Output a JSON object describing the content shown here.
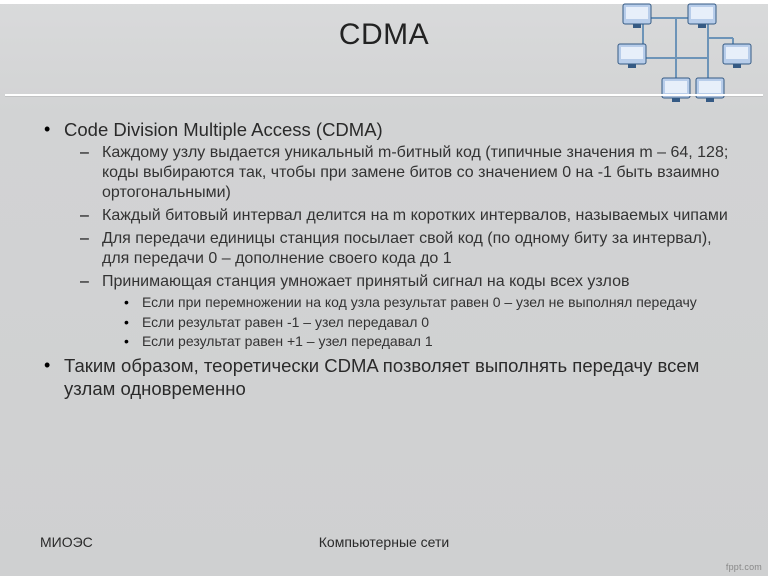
{
  "title": "CDMA",
  "bullets_lvl1_0": "Code Division Multiple Access (CDMA)",
  "bullets_lvl2_0": "Каждому узлу выдается уникальный m-битный код (типичные значения m – 64, 128; коды выбираются так, чтобы при замене битов со значением 0 на -1 быть взаимно ортогональными)",
  "bullets_lvl2_1": "Каждый битовый интервал делится на m коротких интервалов, называемых чипами",
  "bullets_lvl2_2": "Для передачи единицы станция посылает свой код (по одному биту за интервал), для передачи 0 – дополнение своего кода до 1",
  "bullets_lvl2_3": "Принимающая станция умножает принятый сигнал на коды всех узлов",
  "bullets_lvl3_0": "Если при перемножении на код узла результат равен 0 – узел не выполнял передачу",
  "bullets_lvl3_1": "Если результат равен -1 – узел передавал 0",
  "bullets_lvl3_2": "Если результат равен +1 – узел передавал 1",
  "bullets_lvl1_1": "Таким образом, теоретически CDMA позволяет выполнять передачу всем узлам одновременно",
  "footer_left": "МИОЭС",
  "footer_center": "Компьютерные сети",
  "brand": "fppt.com"
}
